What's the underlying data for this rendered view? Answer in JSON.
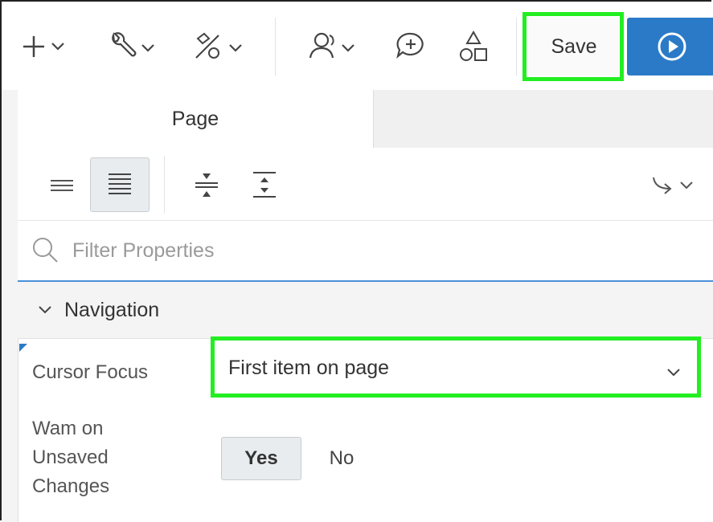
{
  "toolbar": {
    "items": [
      {
        "icon": "plus-icon"
      },
      {
        "icon": "wrench-icon"
      },
      {
        "icon": "utilities-icon"
      },
      {
        "icon": "team-icon"
      },
      {
        "icon": "comment-add-icon"
      },
      {
        "icon": "shapes-icon"
      }
    ],
    "save_label": "Save",
    "run_icon": "play-circle-icon",
    "run_color": "#2a7ac7"
  },
  "tabs": [
    {
      "label": "Page",
      "active": true
    }
  ],
  "viewbar": {
    "buttons": [
      "collapse-rows-icon",
      "expand-rows-icon",
      "collapse-all-icon",
      "expand-all-icon"
    ],
    "goto_icon": "go-to-group-icon"
  },
  "filter": {
    "placeholder": "Filter Properties"
  },
  "section": {
    "title": "Navigation"
  },
  "properties": [
    {
      "label": "Cursor Focus",
      "value": "First item on page"
    },
    {
      "label_lines": [
        "Wam on",
        "Unsaved",
        "Changes"
      ],
      "options": [
        "Yes",
        "No"
      ],
      "selected": "Yes"
    }
  ],
  "highlight_color": "#22ee22"
}
